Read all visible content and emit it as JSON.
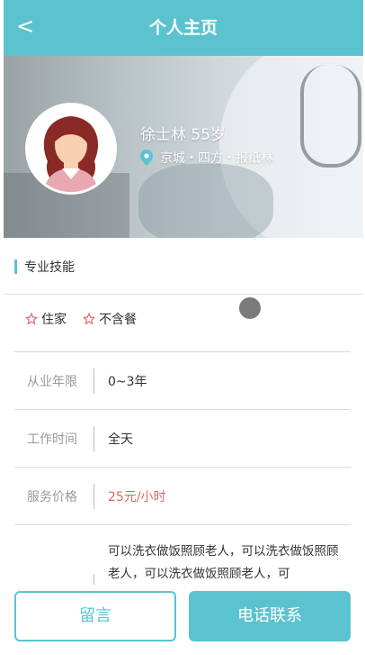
{
  "header": {
    "back_label": "<",
    "title": "个人主页"
  },
  "profile": {
    "name_age": "徐士林 55岁",
    "location": "京城・四方・报纸林"
  },
  "section": {
    "title": "专业技能"
  },
  "tags": [
    {
      "label": "住家"
    },
    {
      "label": "不含餐"
    }
  ],
  "details": [
    {
      "label": "从业年限",
      "value": "0~3年"
    },
    {
      "label": "工作时间",
      "value": "全天"
    },
    {
      "label": "服务价格",
      "value": "25元/小时"
    }
  ],
  "description": "可以洗衣做饭照顾老人，可以洗衣做饭照顾老人，可以洗衣做饭照顾老人，可",
  "actions": {
    "message_label": "留言",
    "call_label": "电话联系"
  },
  "colors": {
    "accent": "#5bc3cf",
    "price": "#e06666",
    "star": "#e06666"
  }
}
